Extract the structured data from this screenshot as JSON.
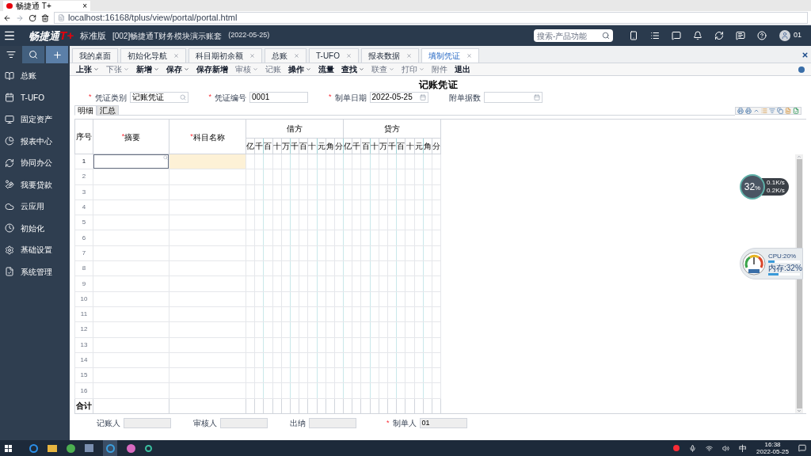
{
  "browser": {
    "tab_title": "畅捷通 T+",
    "tab_close": "×",
    "url": "localhost:16168/tplus/view/portal/portal.html"
  },
  "header": {
    "logo": "畅捷通",
    "logo_mark": "T+",
    "edition": "标准版",
    "account": "[002]畅捷通T财务模块演示账套",
    "date": "(2022-05-25)",
    "search": {
      "placeholder": "搜索-产品功能"
    },
    "user": "01"
  },
  "sidebar": {
    "items": [
      {
        "label": "总账"
      },
      {
        "label": "T-UFO"
      },
      {
        "label": "固定资产"
      },
      {
        "label": "报表中心"
      },
      {
        "label": "协同办公"
      },
      {
        "label": "我要贷款"
      },
      {
        "label": "云应用"
      },
      {
        "label": "初始化"
      },
      {
        "label": "基础设置"
      },
      {
        "label": "系统管理"
      }
    ]
  },
  "tabs": [
    {
      "label": "我的桌面",
      "closable": false,
      "selected": false
    },
    {
      "label": "初始化导航",
      "closable": true,
      "selected": false
    },
    {
      "label": "科目期初余额",
      "closable": true,
      "selected": false
    },
    {
      "label": "总账",
      "closable": true,
      "selected": false
    },
    {
      "label": "T-UFO",
      "closable": true,
      "selected": false
    },
    {
      "label": "报表数据",
      "closable": true,
      "selected": false
    },
    {
      "label": "填制凭证",
      "closable": true,
      "selected": true
    }
  ],
  "toolbar": [
    {
      "label": "上张",
      "dropdown": true,
      "disabled": false
    },
    {
      "label": "下张",
      "dropdown": true,
      "disabled": true
    },
    {
      "label": "新增",
      "dropdown": true,
      "disabled": false
    },
    {
      "label": "保存",
      "dropdown": true,
      "disabled": false
    },
    {
      "label": "保存新增",
      "dropdown": false,
      "disabled": false
    },
    {
      "label": "审核",
      "dropdown": true,
      "disabled": true
    },
    {
      "label": "记账",
      "dropdown": false,
      "disabled": true
    },
    {
      "label": "操作",
      "dropdown": true,
      "disabled": false
    },
    {
      "label": "流量",
      "dropdown": false,
      "disabled": false
    },
    {
      "label": "查找",
      "dropdown": true,
      "disabled": false
    },
    {
      "label": "联查",
      "dropdown": true,
      "disabled": true
    },
    {
      "label": "打印",
      "dropdown": true,
      "disabled": true
    },
    {
      "label": "附件",
      "dropdown": false,
      "disabled": true
    },
    {
      "label": "退出",
      "dropdown": false,
      "disabled": false
    }
  ],
  "voucher": {
    "title": "记账凭证",
    "fields": [
      {
        "mark": "*",
        "label": "凭证类别",
        "value": "记账凭证",
        "kind": "lookup"
      },
      {
        "mark": "*",
        "label": "凭证编号",
        "value": "0001",
        "kind": "text"
      },
      {
        "mark": "*",
        "label": "制单日期",
        "value": "2022-05-25",
        "kind": "date"
      },
      {
        "label": "附单据数",
        "kind": "date"
      }
    ],
    "view_tabs": [
      {
        "label": "明细",
        "selected": true
      },
      {
        "label": "汇总",
        "selected": false
      }
    ],
    "columns": {
      "no": "序号",
      "summary_mark": "*",
      "summary": "摘要",
      "account_mark": "*",
      "account": "科目名称",
      "debit": "借方",
      "credit": "贷方",
      "debit_digits": [
        "亿",
        "千",
        "百",
        "十",
        "万",
        "千",
        "百",
        "十",
        "元",
        "角",
        "分"
      ],
      "credit_digits": [
        "亿",
        "千",
        "百",
        "十",
        "万",
        "千",
        "百",
        "十",
        "元",
        "角",
        "分"
      ]
    },
    "rows": [
      {
        "no": "1",
        "selected": true
      },
      {
        "no": "2",
        "selected": false
      },
      {
        "no": "3",
        "selected": false
      },
      {
        "no": "4",
        "selected": false
      },
      {
        "no": "5",
        "selected": false
      },
      {
        "no": "6",
        "selected": false
      },
      {
        "no": "7",
        "selected": false
      },
      {
        "no": "8",
        "selected": false
      },
      {
        "no": "9",
        "selected": false
      },
      {
        "no": "10",
        "selected": false
      },
      {
        "no": "11",
        "selected": false
      },
      {
        "no": "12",
        "selected": false
      },
      {
        "no": "13",
        "selected": false
      },
      {
        "no": "14",
        "selected": false
      },
      {
        "no": "15",
        "selected": false
      },
      {
        "no": "16",
        "selected": false
      }
    ],
    "total_label": "合计",
    "signatures": [
      {
        "label": "记账人"
      },
      {
        "label": "审核人"
      },
      {
        "label": "出纳"
      },
      {
        "mark": "*",
        "label": "制单人",
        "value": "01"
      }
    ]
  },
  "net_widget": {
    "percent": "32",
    "unit": "%",
    "up": "0.1",
    "up_unit": "K/s",
    "down": "0.2",
    "down_unit": "K/s"
  },
  "sys_widget": {
    "cpu": {
      "reading": "CPU:20%",
      "level": 0.2
    },
    "memory": {
      "reading": "内存:32%",
      "level": 0.32
    }
  },
  "taskbar": {
    "tray_lang": "中",
    "time": "16:38",
    "date": "2022-05-25"
  }
}
